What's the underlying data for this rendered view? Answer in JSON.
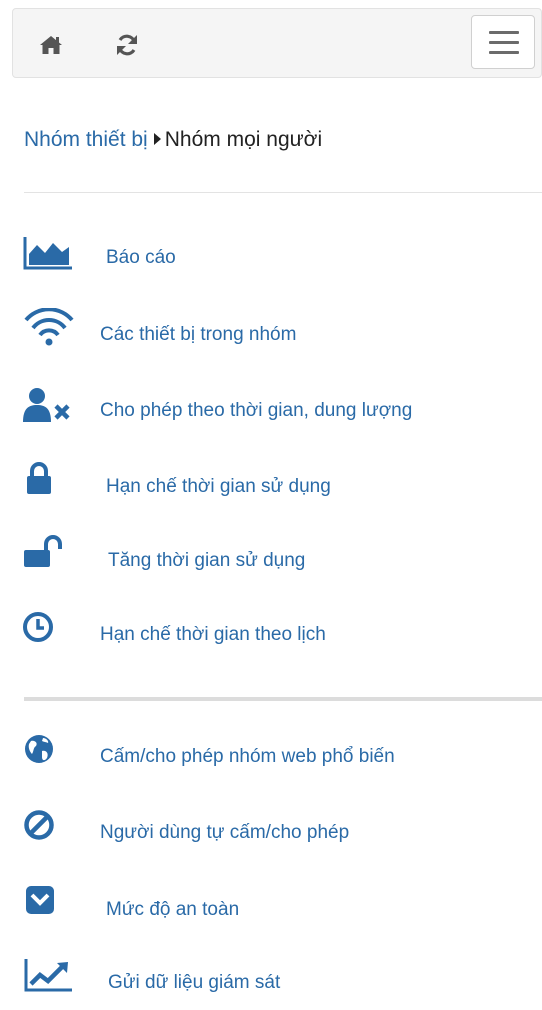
{
  "colors": {
    "accent": "#2a6aa7",
    "text_dark": "#222222",
    "topbar_bg": "#f5f5f5",
    "icon_gray": "#555555"
  },
  "toolbar": {
    "home_icon": "home-icon",
    "refresh_icon": "refresh-icon",
    "menu_icon": "hamburger-menu-icon"
  },
  "breadcrumb": {
    "parent": "Nhóm thiết bị",
    "current": "Nhóm mọi người"
  },
  "menu": {
    "items": [
      {
        "label": "Báo cáo",
        "icon": "area-chart-icon"
      },
      {
        "label": "Các thiết bị trong nhóm",
        "icon": "wifi-icon"
      },
      {
        "label": "Cho phép theo thời gian, dung lượng",
        "icon": "user-times-icon"
      },
      {
        "label": "Hạn chế thời gian sử dụng",
        "icon": "lock-icon"
      },
      {
        "label": "Tăng thời gian sử dụng",
        "icon": "unlock-icon"
      },
      {
        "label": "Hạn chế thời gian theo lịch",
        "icon": "clock-icon"
      }
    ],
    "items2": [
      {
        "label": "Cấm/cho phép nhóm web phổ biến",
        "icon": "globe-icon"
      },
      {
        "label": "Người dùng tự cấm/cho phép",
        "icon": "ban-icon"
      },
      {
        "label": "Mức độ an toàn",
        "icon": "chevron-down-square-icon"
      },
      {
        "label": "Gửi dữ liệu giám sát",
        "icon": "line-chart-icon"
      }
    ]
  }
}
